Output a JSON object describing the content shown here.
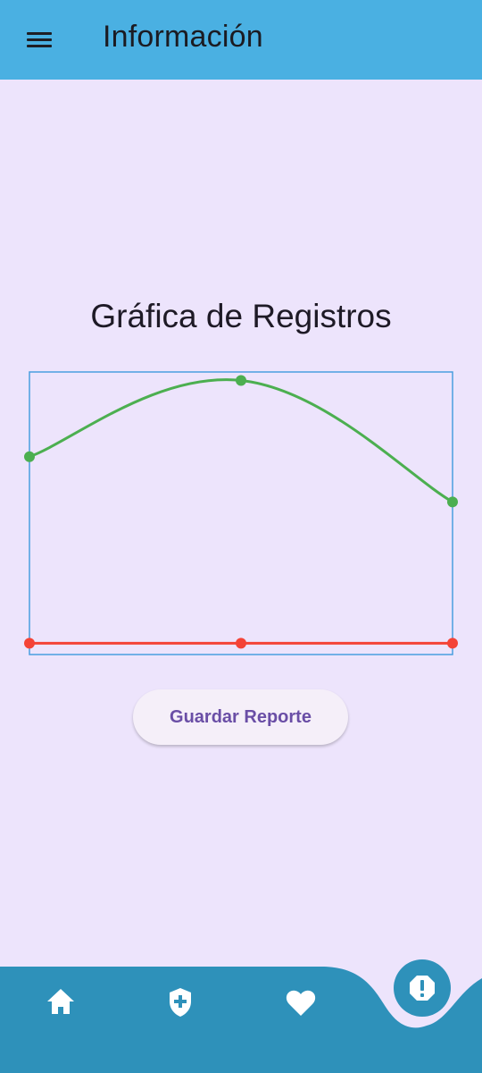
{
  "app_bar": {
    "title": "Información",
    "menu_icon": "menu-icon",
    "color": "#4ab0e2"
  },
  "main": {
    "background": "#ede4fc",
    "chart_title": "Gráfica de Registros",
    "save_button_label": "Guardar Reporte"
  },
  "chart_data": {
    "type": "line",
    "title": "Gráfica de Registros",
    "xlabel": "",
    "ylabel": "",
    "x": [
      0,
      1,
      2
    ],
    "ylim": [
      0,
      100
    ],
    "grid": false,
    "series": [
      {
        "color": "#4caf50",
        "values": [
          70,
          97,
          54
        ]
      },
      {
        "color": "#f44336",
        "values": [
          4,
          4,
          4
        ]
      }
    ]
  },
  "bottom_nav": {
    "background": "#2e91ba",
    "items": [
      {
        "icon": "home-icon"
      },
      {
        "icon": "shield-plus-icon"
      },
      {
        "icon": "heart-icon"
      }
    ],
    "fab_icon": "alert-octagon-icon"
  }
}
